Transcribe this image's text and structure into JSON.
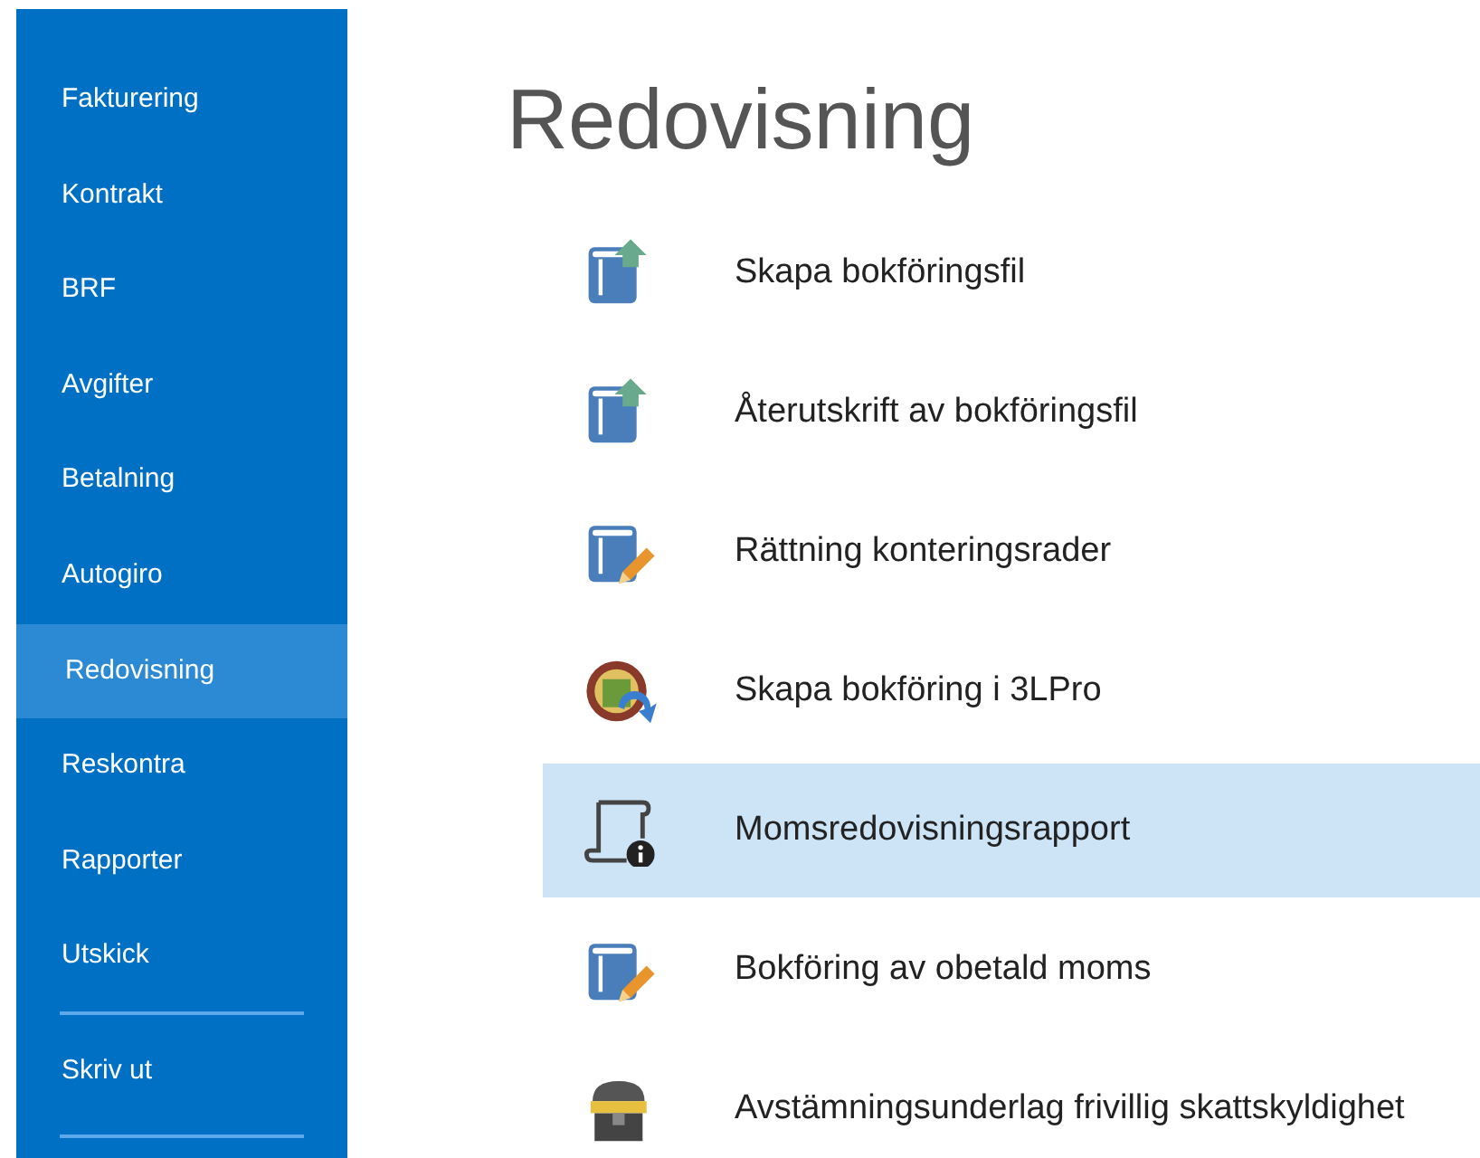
{
  "sidebar": {
    "items": [
      {
        "label": "Fakturering",
        "selected": false
      },
      {
        "label": "Kontrakt",
        "selected": false
      },
      {
        "label": "BRF",
        "selected": false
      },
      {
        "label": "Avgifter",
        "selected": false
      },
      {
        "label": "Betalning",
        "selected": false
      },
      {
        "label": "Autogiro",
        "selected": false
      },
      {
        "label": "Redovisning",
        "selected": true
      },
      {
        "label": "Reskontra",
        "selected": false
      },
      {
        "label": "Rapporter",
        "selected": false
      },
      {
        "label": "Utskick",
        "selected": false
      }
    ],
    "bottom_items": [
      {
        "label": "Skriv ut",
        "selected": false
      }
    ]
  },
  "page": {
    "title": "Redovisning",
    "items": [
      {
        "label": "Skapa bokföringsfil",
        "kind": "export",
        "selected": false
      },
      {
        "label": "Återutskrift av bokföringsfil",
        "kind": "export",
        "selected": false
      },
      {
        "label": "Rättning konteringsrader",
        "kind": "edit",
        "selected": false
      },
      {
        "label": "Skapa bokföring i 3LPro",
        "kind": "sync",
        "selected": false
      },
      {
        "label": "Momsredovisningsrapport",
        "kind": "report",
        "selected": true
      },
      {
        "label": "Bokföring av obetald moms",
        "kind": "edit",
        "selected": false
      },
      {
        "label": "Avstämningsunderlag frivillig skattskyldighet",
        "kind": "chest",
        "selected": false
      }
    ]
  }
}
